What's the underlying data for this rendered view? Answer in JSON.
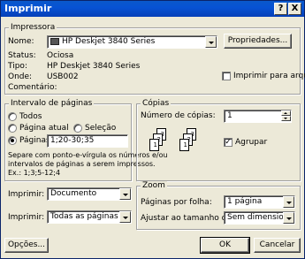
{
  "window": {
    "title": "Imprimir",
    "help_label": "?",
    "close_label": "X"
  },
  "printer_group": {
    "legend": "Impressora",
    "name_label": "Nome:",
    "name_value": "HP Deskjet 3840 Series",
    "properties_label": "Propriedades...",
    "status_label": "Status:",
    "status_value": "Ociosa",
    "type_label": "Tipo:",
    "type_value": "HP Deskjet 3840 Series",
    "where_label": "Onde:",
    "where_value": "USB002",
    "comment_label": "Comentário:",
    "print_to_file_label": "Imprimir para arquivo",
    "print_to_file_checked": false
  },
  "page_range": {
    "legend": "Intervalo de páginas",
    "all_label": "Todos",
    "current_label": "Página atual",
    "selection_label": "Seleção",
    "pages_label": "Páginas:",
    "pages_value": "1;20-30;35",
    "selected": "pages",
    "hint_line1": "Separe com ponto-e-vírgula os números e/ou",
    "hint_line2": "intervalos de páginas a serem impressos.",
    "hint_line3": "Ex.: 1;3;5-12;4"
  },
  "copies": {
    "legend": "Cópias",
    "count_label": "Número de cópias:",
    "count_value": "1",
    "collate_label": "Agrupar",
    "collate_checked": true,
    "page_numbers": [
      "1",
      "2",
      "3"
    ]
  },
  "print_what": {
    "label": "Imprimir:",
    "value": "Documento"
  },
  "print_range": {
    "label": "Imprimir:",
    "value": "Todas as páginas do intervalo"
  },
  "zoom": {
    "legend": "Zoom",
    "pages_per_sheet_label": "Páginas por folha:",
    "pages_per_sheet_value": "1 página",
    "scale_label": "Ajustar ao tamanho do papel:",
    "scale_value": "Sem dimensionamento"
  },
  "buttons": {
    "options": "Opções...",
    "ok": "OK",
    "cancel": "Cancelar"
  }
}
